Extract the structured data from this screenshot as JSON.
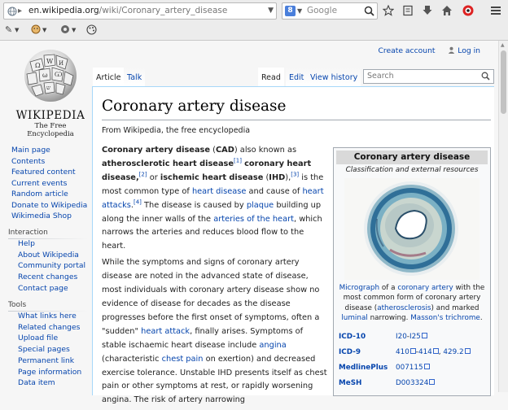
{
  "browser": {
    "url_host": "en.wikipedia.org",
    "url_path": "/wiki/Coronary_artery_disease",
    "search_engine_letter": "8",
    "search_placeholder": "Google"
  },
  "personal": {
    "create_account": "Create account",
    "log_in": "Log in"
  },
  "logo": {
    "wordmark": "WIKIPEDIA",
    "tagline": "The Free Encyclopedia"
  },
  "nav": {
    "main": [
      "Main page",
      "Contents",
      "Featured content",
      "Current events",
      "Random article",
      "Donate to Wikipedia",
      "Wikimedia Shop"
    ],
    "interaction_heading": "Interaction",
    "interaction": [
      "Help",
      "About Wikipedia",
      "Community portal",
      "Recent changes",
      "Contact page"
    ],
    "tools_heading": "Tools",
    "tools": [
      "What links here",
      "Related changes",
      "Upload file",
      "Special pages",
      "Permanent link",
      "Page information",
      "Data item"
    ]
  },
  "tabs": {
    "article": "Article",
    "talk": "Talk",
    "read": "Read",
    "edit": "Edit",
    "history": "View history",
    "search_placeholder": "Search"
  },
  "article": {
    "title": "Coronary artery disease",
    "from": "From Wikipedia, the free encyclopedia",
    "p1": {
      "t1": "Coronary artery disease",
      "t2": " (",
      "t3": "CAD",
      "t4": ") also known as ",
      "t5": "atherosclerotic heart disease",
      "r1": "[1]",
      "t6": " ",
      "t7": "coronary heart disease",
      "t8": ",",
      "r2": "[2]",
      "t9": " or ",
      "t10": "ischemic heart disease",
      "t11": " (",
      "t12": "IHD",
      "t13": "),",
      "r3": "[3]",
      "t14": " is the most common type of ",
      "l1": "heart disease",
      "t15": " and cause of ",
      "l2": "heart attacks",
      "t16": ".",
      "r4": "[4]",
      "t17": " The disease is caused by ",
      "l3": "plaque",
      "t18": " building up along the inner walls of the ",
      "l4": "arteries of the heart",
      "t19": ", which narrows the arteries and reduces blood flow to the heart."
    },
    "p2": {
      "t1": "While the symptoms and signs of coronary artery disease are noted in the advanced state of disease, most individuals with coronary artery disease show no evidence of disease for decades as the disease progresses before the first onset of symptoms, often a \"sudden\" ",
      "l1": "heart attack",
      "t2": ", finally arises. Symptoms of stable ischaemic heart disease include ",
      "l2": "angina",
      "t3": " (characteristic ",
      "l3": "chest pain",
      "t4": " on exertion) and decreased exercise tolerance. Unstable IHD presents itself as chest pain or other symptoms at rest, or rapidly worsening angina. The risk of artery narrowing"
    }
  },
  "infobox": {
    "title": "Coronary artery disease",
    "subtitle": "Classification and external resources",
    "caption": {
      "l1": "Micrograph",
      "t1": " of a ",
      "l2": "coronary artery",
      "t2": " with the most common form of coronary artery disease (",
      "l3": "atherosclerosis",
      "t3": ") and marked ",
      "l4": "luminal",
      "t4": " narrowing. ",
      "l5": "Masson's trichrome",
      "t5": "."
    },
    "rows": [
      {
        "key": "ICD-10",
        "parts": [
          "I20",
          "-",
          "I25"
        ]
      },
      {
        "key": "ICD-9",
        "parts": [
          "410",
          "-",
          "414",
          ", ",
          "429.2"
        ]
      },
      {
        "key": "MedlinePlus",
        "parts": [
          "007115"
        ]
      },
      {
        "key": "MeSH",
        "parts": [
          "D003324"
        ]
      }
    ]
  }
}
